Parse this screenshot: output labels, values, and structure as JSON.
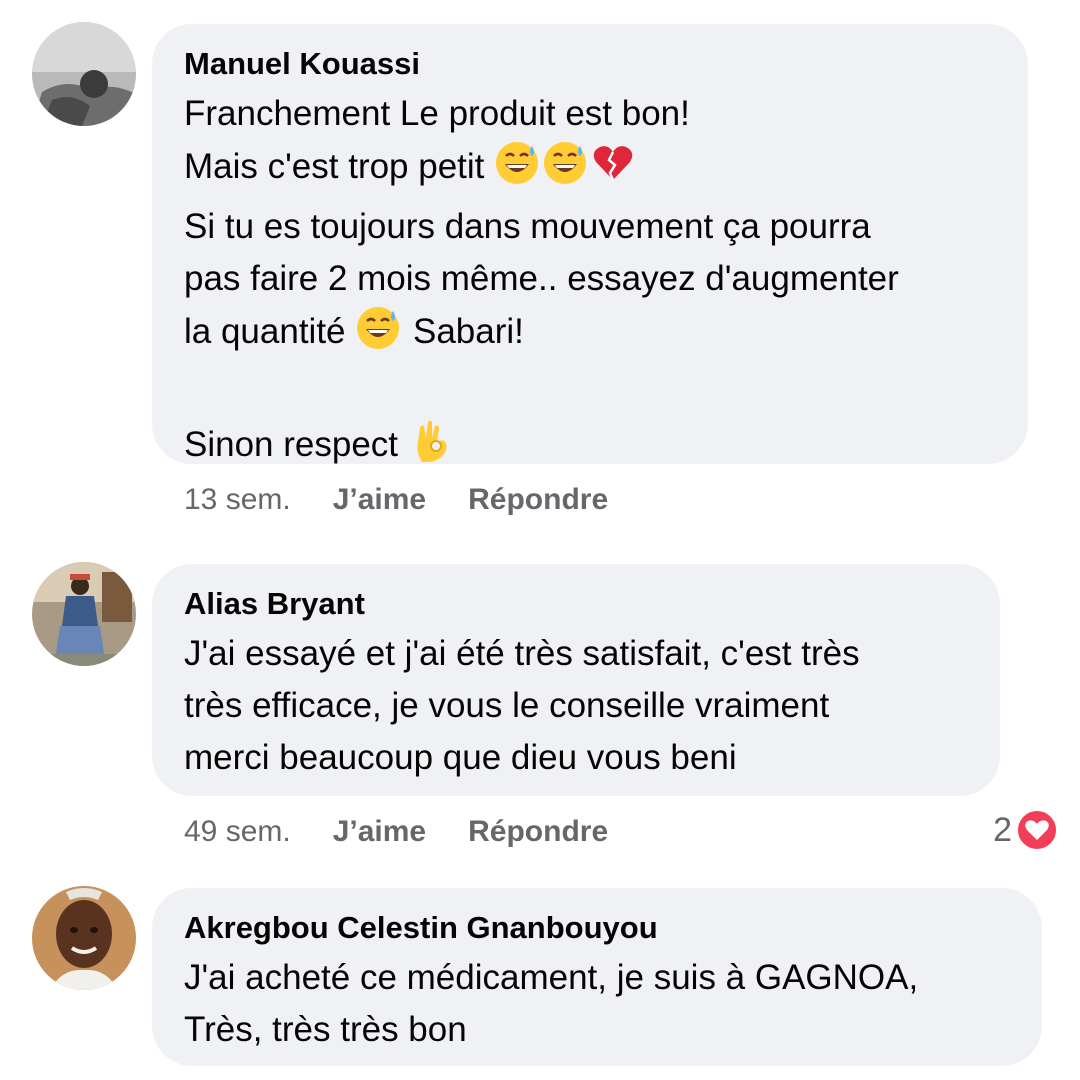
{
  "comments": [
    {
      "author": "Manuel Kouassi",
      "lines": [
        {
          "text": "Franchement Le produit est bon!",
          "emojis": []
        },
        {
          "text": "Mais c'est trop petit ",
          "emojis": [
            "grinning-sweat-emoji",
            "grinning-sweat-emoji",
            "broken-heart-emoji"
          ]
        },
        {
          "text": "Si tu es toujours dans mouvement ça pourra",
          "emojis": []
        },
        {
          "text": "pas faire 2 mois même.. essayez d'augmenter",
          "emojis": []
        },
        {
          "text": "la quantité ",
          "emojis": [
            "grinning-sweat-emoji"
          ],
          "after": " Sabari!"
        },
        {
          "text": "",
          "emojis": []
        },
        {
          "text": "Sinon respect ",
          "emojis": [
            "ok-hand-emoji"
          ]
        }
      ],
      "time": "13 sem.",
      "like_label": "J’aime",
      "reply_label": "Répondre"
    },
    {
      "author": "Alias Bryant",
      "lines": [
        {
          "text": "J'ai essayé et j'ai été très satisfait, c'est très",
          "emojis": []
        },
        {
          "text": "très efficace, je vous le conseille vraiment",
          "emojis": []
        },
        {
          "text": "merci beaucoup que dieu vous beni",
          "emojis": []
        }
      ],
      "time": "49 sem.",
      "like_label": "J’aime",
      "reply_label": "Répondre",
      "reaction_count": "2",
      "reaction_icon": "heart-reaction-icon"
    },
    {
      "author": "Akregbou Celestin Gnanbouyou",
      "lines": [
        {
          "text": "J'ai acheté ce médicament, je suis à GAGNOA,",
          "emojis": []
        },
        {
          "text": "Très, très très bon",
          "emojis": []
        }
      ]
    }
  ],
  "colors": {
    "bubble": "#f0f1f4",
    "meta_text": "#65676b",
    "heart": "#f33e58"
  }
}
